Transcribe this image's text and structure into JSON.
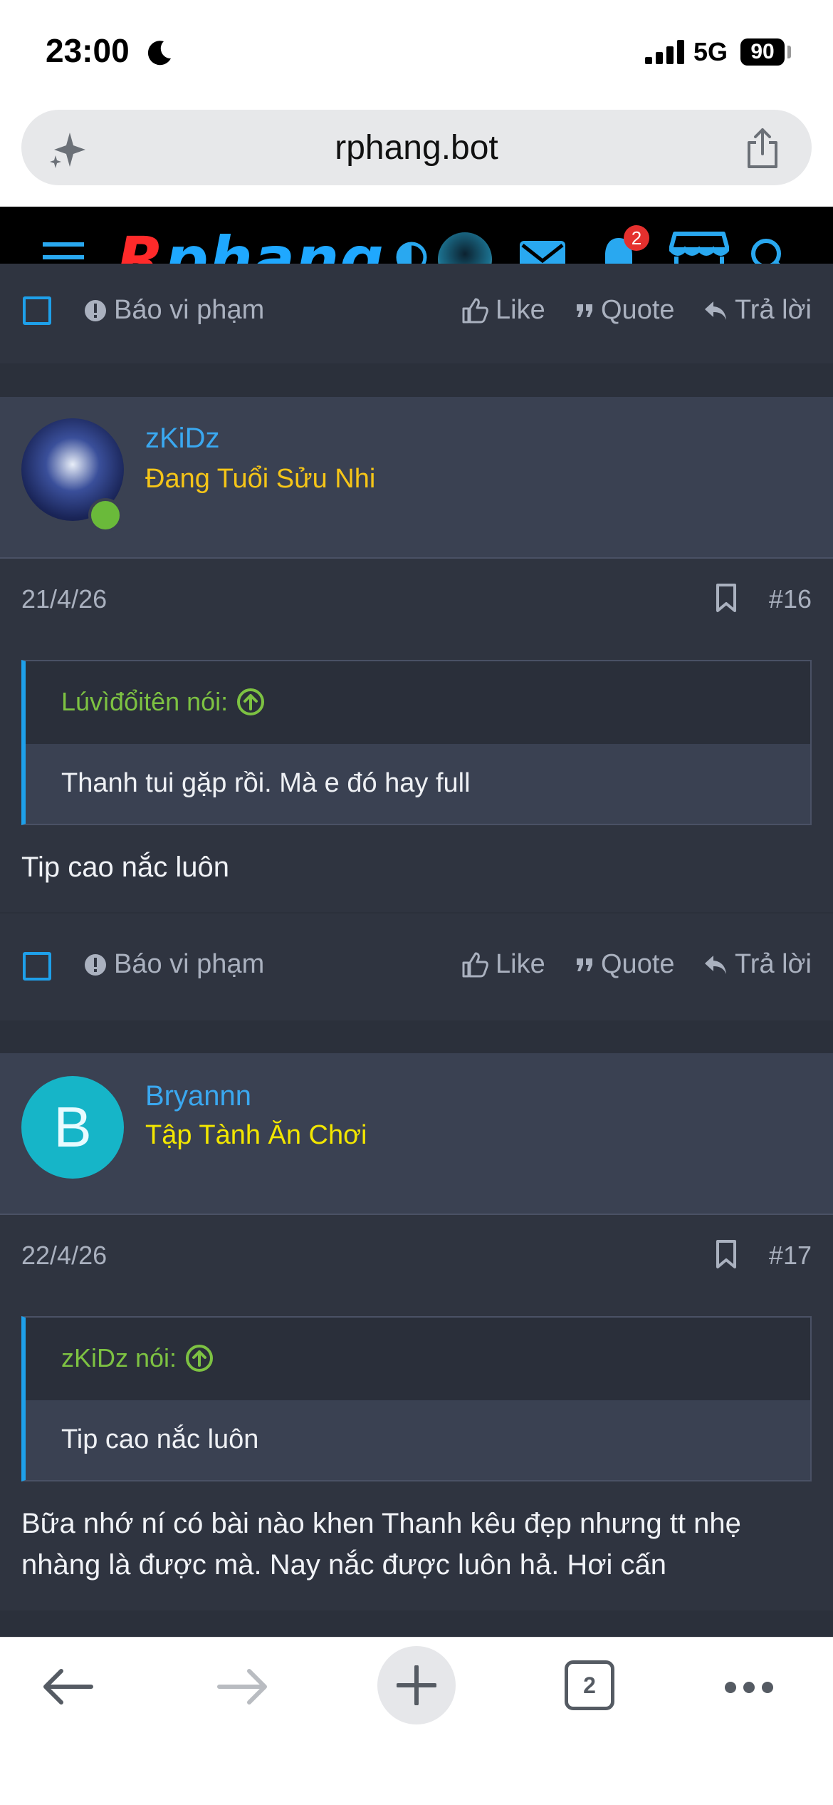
{
  "status_bar": {
    "time": "23:00",
    "network": "5G",
    "battery": "90"
  },
  "browser": {
    "url": "rphang.bot",
    "tab_count": "2"
  },
  "site_header": {
    "logo": "Rphang",
    "notification_count": "2"
  },
  "actions": {
    "report": "Báo vi phạm",
    "like": "Like",
    "quote": "Quote",
    "reply": "Trả lời"
  },
  "posts": [
    {
      "username": "zKiDz",
      "user_title": "Đang Tuổi Sửu Nhi",
      "user_title_color": "#f5c518",
      "date": "21/4/26",
      "number": "#16",
      "quote_author": "Lúvìđổitên nói:",
      "quote_text": "Thanh tui gặp rồi. Mà e đó hay full",
      "message": "Tip cao nắc luôn"
    },
    {
      "username": "Bryannn",
      "avatar_letter": "B",
      "avatar_color": "#16b5c8",
      "user_title": "Tập Tành Ăn Chơi",
      "user_title_color": "#f2e600",
      "date": "22/4/26",
      "number": "#17",
      "quote_author": "zKiDz nói:",
      "quote_text": "Tip cao nắc luôn",
      "message": "Bữa nhớ ní có bài nào khen Thanh kêu đẹp nhưng tt nhẹ nhàng là được mà. Nay nắc được luôn hả. Hơi cấn"
    }
  ]
}
